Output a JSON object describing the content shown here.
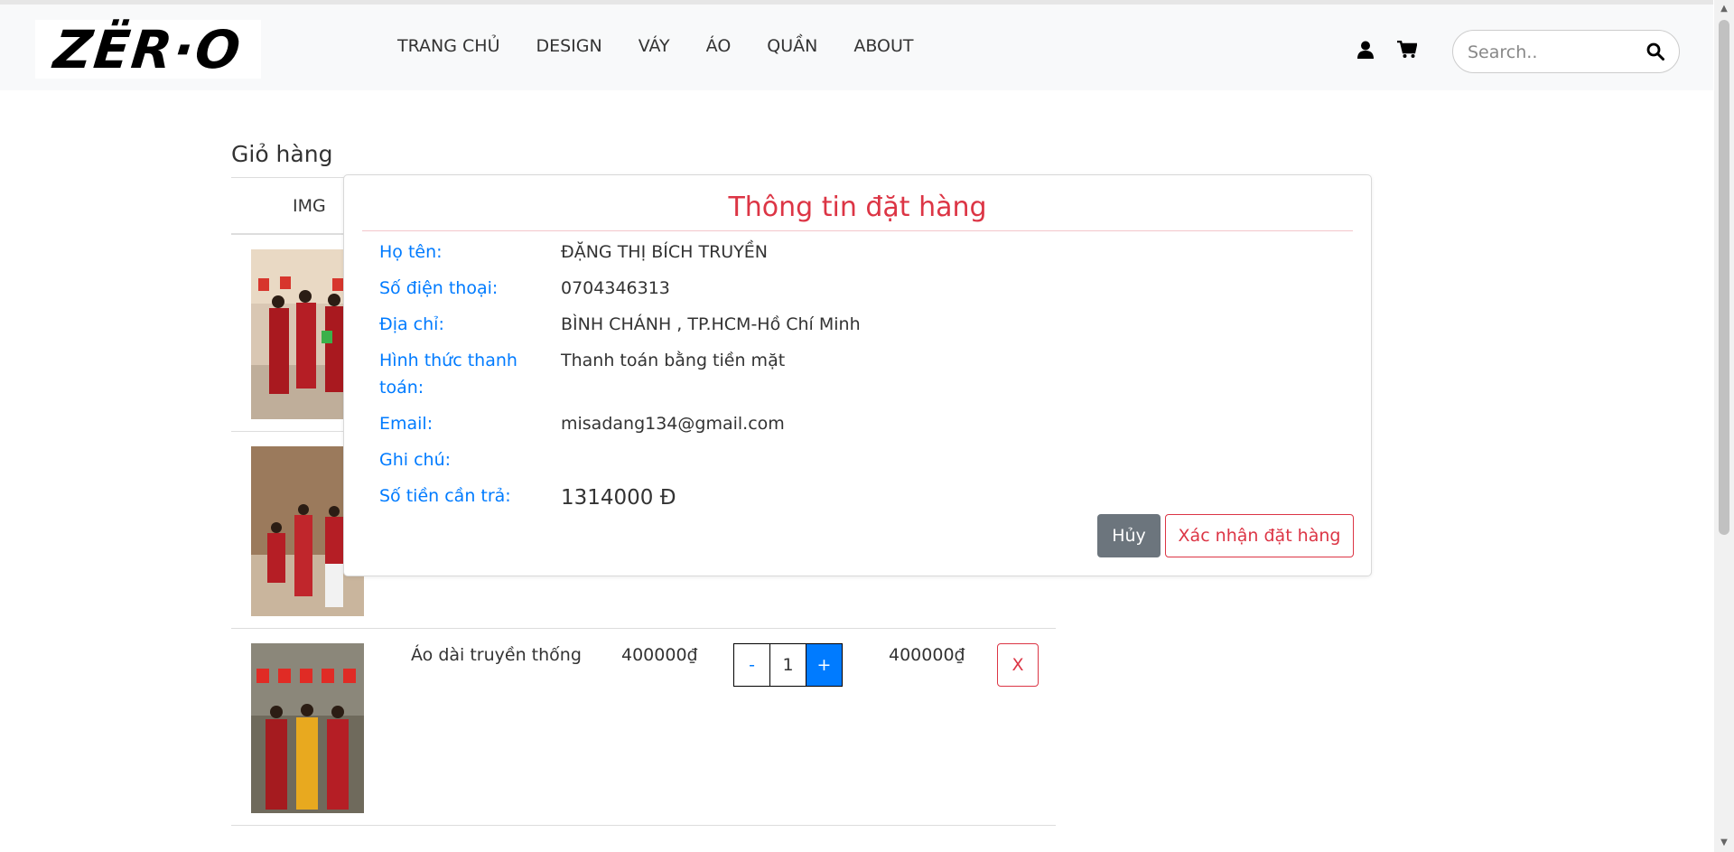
{
  "header": {
    "logo_text": "ZËR·O",
    "nav": [
      "TRANG CHỦ",
      "DESIGN",
      "VÁY",
      "ÁO",
      "QUẦN",
      "ABOUT"
    ],
    "icons": [
      "user-icon",
      "cart-icon"
    ],
    "search": {
      "placeholder": "Search..",
      "icon": "search-icon"
    }
  },
  "cart": {
    "title": "Giỏ hàng",
    "columns": [
      "IMG"
    ],
    "rows": [
      {
        "image": "Áo dài photo 1",
        "name": "",
        "price": "",
        "qty": "",
        "total": ""
      },
      {
        "image": "Áo dài photo 2",
        "name": "",
        "price": "",
        "qty": "",
        "total": ""
      },
      {
        "image": "Áo dài photo 3",
        "name": "Áo dài truyền thống",
        "price": "400000₫",
        "qty": "1",
        "total": "400000₫",
        "minus": "-",
        "plus": "+",
        "remove": "X"
      }
    ]
  },
  "modal": {
    "title": "Thông tin đặt hàng",
    "fields": [
      {
        "label": "Họ tên:",
        "value": "ĐẶNG THỊ BÍCH TRUYỀN"
      },
      {
        "label": "Số điện thoại:",
        "value": "0704346313"
      },
      {
        "label": "Địa chỉ:",
        "value": "BÌNH CHÁNH , TP.HCM-Hồ Chí Minh"
      },
      {
        "label": "Hình thức thanh toán:",
        "value": "Thanh toán bằng tiền mặt"
      },
      {
        "label": "Email:",
        "value": "misadang134@gmail.com"
      },
      {
        "label": "Ghi chú:",
        "value": ""
      },
      {
        "label": "Số tiền cần trả:",
        "value": "1314000 Đ"
      }
    ],
    "cancel_label": "Hủy",
    "confirm_label": "Xác nhận đặt hàng"
  },
  "colors": {
    "accent": "#dc3545",
    "label": "#007bff",
    "cancel": "#6c757d"
  }
}
